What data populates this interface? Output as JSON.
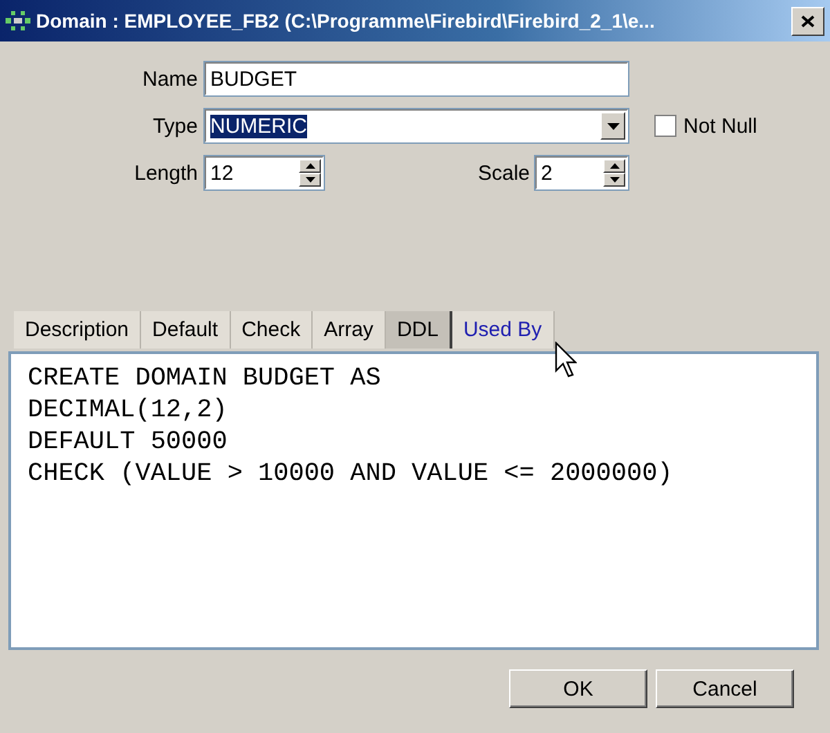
{
  "window": {
    "title": "Domain : EMPLOYEE_FB2 (C:\\Programme\\Firebird\\Firebird_2_1\\e..."
  },
  "name_field": {
    "label": "Name",
    "value": "BUDGET"
  },
  "type_field": {
    "label": "Type",
    "value": "NUMERIC",
    "highlighted": true
  },
  "not_null": {
    "label": "Not Null",
    "checked": false
  },
  "length_field": {
    "label": "Length",
    "value": "12"
  },
  "scale_field": {
    "label": "Scale",
    "value": "2"
  },
  "tabs": [
    {
      "label": "Description",
      "selected": false,
      "hovered": false
    },
    {
      "label": "Default",
      "selected": false,
      "hovered": false
    },
    {
      "label": "Check",
      "selected": false,
      "hovered": false
    },
    {
      "label": "Array",
      "selected": false,
      "hovered": false
    },
    {
      "label": "DDL",
      "selected": true,
      "hovered": false
    },
    {
      "label": "Used By",
      "selected": false,
      "hovered": true
    }
  ],
  "ddl_lines": [
    "CREATE DOMAIN BUDGET AS",
    "DECIMAL(12,2)",
    "DEFAULT 50000",
    "CHECK (VALUE > 10000 AND VALUE <= 2000000)"
  ],
  "buttons": [
    "OK",
    "Cancel"
  ]
}
